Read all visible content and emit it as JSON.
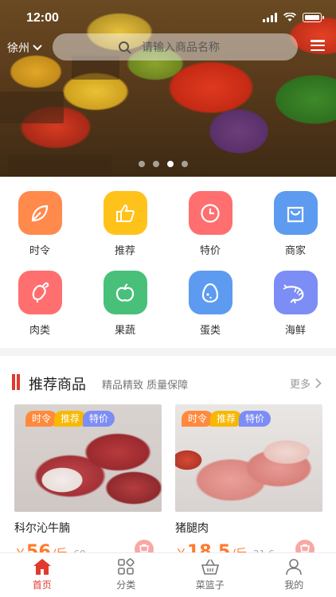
{
  "status": {
    "time": "12:00"
  },
  "header": {
    "city": "徐州",
    "search_placeholder": "请输入商品名称"
  },
  "banner": {
    "slides": 4,
    "active_slide": 3
  },
  "categories": [
    {
      "label": "时令",
      "icon": "leaf-icon",
      "color": "#ff8a4c"
    },
    {
      "label": "推荐",
      "icon": "thumbs-up-icon",
      "color": "#ffc21a"
    },
    {
      "label": "特价",
      "icon": "clock-icon",
      "color": "#ff6f6f"
    },
    {
      "label": "商家",
      "icon": "shopping-bag-icon",
      "color": "#5d9bf0"
    },
    {
      "label": "肉类",
      "icon": "drumstick-icon",
      "color": "#ff6f6f"
    },
    {
      "label": "果蔬",
      "icon": "apple-icon",
      "color": "#48c07a"
    },
    {
      "label": "蛋类",
      "icon": "egg-icon",
      "color": "#5d9bf0"
    },
    {
      "label": "海鲜",
      "icon": "shrimp-icon",
      "color": "#7c8df5"
    }
  ],
  "section": {
    "title": "推荐商品",
    "subtitle": "精品精致 质量保障",
    "more": "更多"
  },
  "products": [
    {
      "name": "科尔沁牛腩",
      "tags": [
        "时令",
        "推荐",
        "特价"
      ],
      "symbol": "￥",
      "price": "56",
      "unit": "/斤",
      "original": "60"
    },
    {
      "name": "猪腿肉",
      "tags": [
        "时令",
        "推荐",
        "特价"
      ],
      "symbol": "￥",
      "price": "18.5",
      "unit": "/斤",
      "original": "21.6"
    }
  ],
  "tabbar": [
    {
      "label": "首页",
      "icon": "home-icon",
      "active": true
    },
    {
      "label": "分类",
      "icon": "category-grid-icon",
      "active": false
    },
    {
      "label": "菜篮子",
      "icon": "basket-icon",
      "active": false
    },
    {
      "label": "我的",
      "icon": "user-icon",
      "active": false
    }
  ],
  "colors": {
    "accent": "#e03a2e",
    "price": "#ff7a2b"
  }
}
